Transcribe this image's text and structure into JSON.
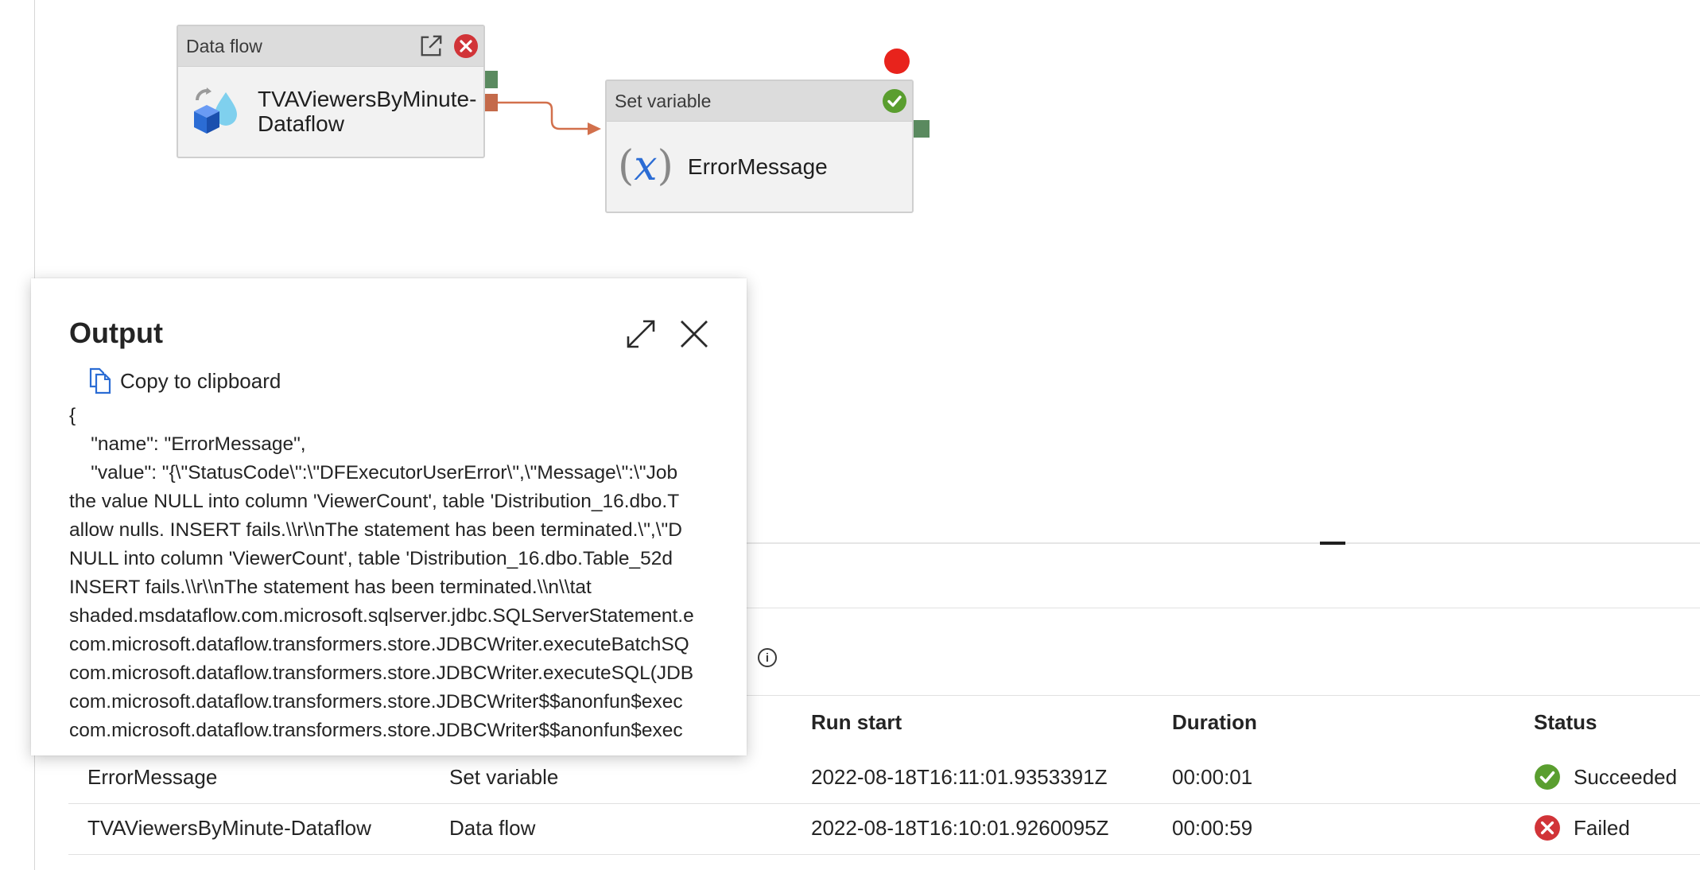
{
  "pipeline": {
    "dataflow_activity": {
      "type_label": "Data flow",
      "name": "TVAViewersByMinute-\nDataflow"
    },
    "setvariable_activity": {
      "type_label": "Set variable",
      "name": "ErrorMessage",
      "glyph": "(x)"
    }
  },
  "output_panel": {
    "title": "Output",
    "copy_label": "Copy to clipboard",
    "json_lines": [
      "{",
      "    \"name\": \"ErrorMessage\",",
      "    \"value\": \"{\\\"StatusCode\\\":\\\"DFExecutorUserError\\\",\\\"Message\\\":\\\"Job",
      "the value NULL into column 'ViewerCount', table 'Distribution_16.dbo.T",
      "allow nulls. INSERT fails.\\\\r\\\\nThe statement has been terminated.\\\",\\\"D",
      "NULL into column 'ViewerCount', table 'Distribution_16.dbo.Table_52d",
      "INSERT fails.\\\\r\\\\nThe statement has been terminated.\\\\n\\\\tat",
      "shaded.msdataflow.com.microsoft.sqlserver.jdbc.SQLServerStatement.e",
      "com.microsoft.dataflow.transformers.store.JDBCWriter.executeBatchSQ",
      "com.microsoft.dataflow.transformers.store.JDBCWriter.executeSQL(JDB",
      "com.microsoft.dataflow.transformers.store.JDBCWriter$$anonfun$exec",
      "com.microsoft.dataflow.transformers.store.JDBCWriter$$anonfun$exec"
    ]
  },
  "runs_table": {
    "columns": [
      "Run start",
      "Duration",
      "Status"
    ],
    "rows": [
      {
        "activity_name": "ErrorMessage",
        "activity_type": "Set variable",
        "run_start": "2022-08-18T16:11:01.9353391Z",
        "duration": "00:00:01",
        "status": "Succeeded"
      },
      {
        "activity_name": "TVAViewersByMinute-Dataflow",
        "activity_type": "Data flow",
        "run_start": "2022-08-18T16:10:01.9260095Z",
        "duration": "00:00:59",
        "status": "Failed"
      }
    ]
  },
  "colors": {
    "success": "#5a9e2f",
    "failure": "#d13438",
    "success_port": "#5a8a5f",
    "failure_port": "#c46a4a",
    "breakpoint": "#e8231c",
    "accent_blue": "#2b6cd4"
  },
  "icons": {
    "dataflow_activity": "dataflow-cube-icon",
    "open_link": "open-in-new-icon",
    "error_badge": "error-circle-icon",
    "success_badge": "success-check-icon",
    "variable": "variable-x-icon",
    "expand": "expand-icon",
    "close": "close-icon",
    "copy": "copy-icon",
    "info": "info-icon",
    "breakpoint": "breakpoint-dot"
  }
}
